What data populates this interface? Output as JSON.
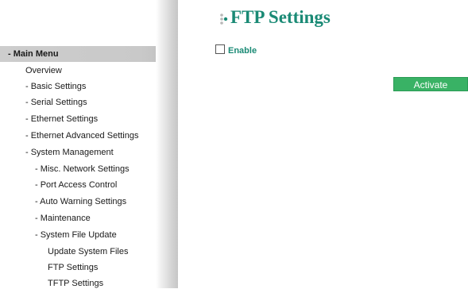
{
  "colors": {
    "accent": "#1a8a75",
    "button_green": "#39b265",
    "menu_header_bg": "#cdcdcd"
  },
  "sidebar": {
    "header": "- Main Menu",
    "items": [
      {
        "label": "Overview",
        "level": 0
      },
      {
        "label": "- Basic Settings",
        "level": 0
      },
      {
        "label": "- Serial Settings",
        "level": 0
      },
      {
        "label": "- Ethernet Settings",
        "level": 0
      },
      {
        "label": "- Ethernet Advanced Settings",
        "level": 0
      },
      {
        "label": "- System Management",
        "level": 0
      },
      {
        "label": "- Misc. Network Settings",
        "level": 1
      },
      {
        "label": "- Port Access Control",
        "level": 1
      },
      {
        "label": "- Auto Warning Settings",
        "level": 1
      },
      {
        "label": "- Maintenance",
        "level": 1
      },
      {
        "label": "- System File Update",
        "level": 1
      },
      {
        "label": "Update System Files",
        "level": 2
      },
      {
        "label": "FTP Settings",
        "level": 2
      },
      {
        "label": "TFTP Settings",
        "level": 2
      }
    ]
  },
  "main": {
    "title": "FTP Settings",
    "title_icon": "dots-bullet-icon",
    "enable_label": "Enable",
    "enable_checked": false,
    "activate_label": "Activate"
  }
}
